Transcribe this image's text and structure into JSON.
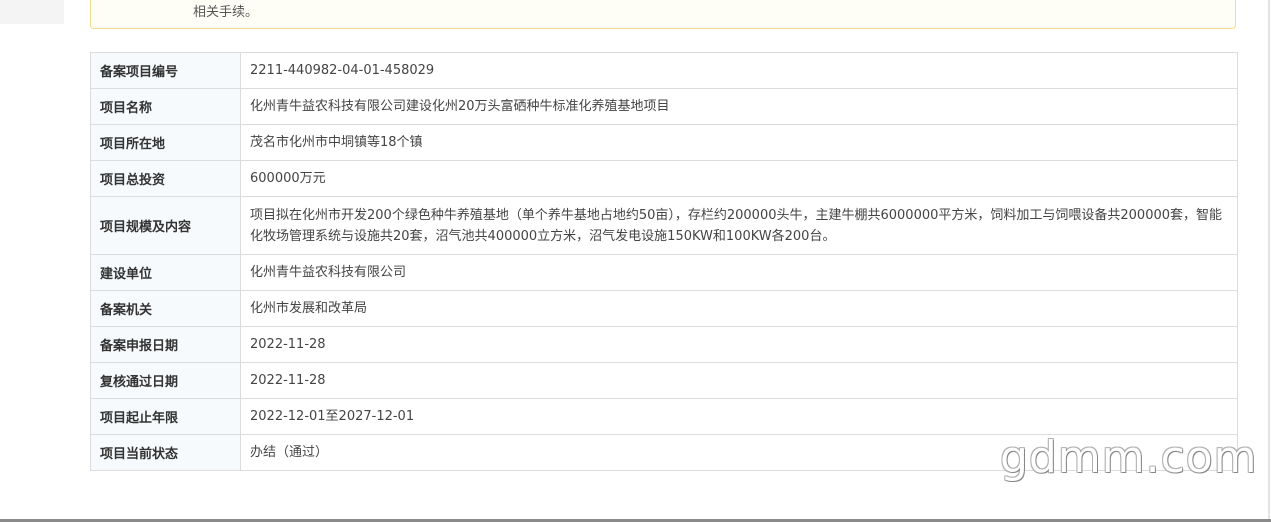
{
  "notice": {
    "text": "相关手续。"
  },
  "record": {
    "rows": [
      {
        "label": "备案项目编号",
        "value": "2211-440982-04-01-458029"
      },
      {
        "label": "项目名称",
        "value": "化州青牛益农科技有限公司建设化州20万头富硒种牛标准化养殖基地项目"
      },
      {
        "label": "项目所在地",
        "value": "茂名市化州市中垌镇等18个镇"
      },
      {
        "label": "项目总投资",
        "value": "600000万元"
      },
      {
        "label": "项目规模及内容",
        "value": "项目拟在化州市开发200个绿色种牛养殖基地（单个养牛基地占地约50亩），存栏约200000头牛，主建牛棚共6000000平方米，饲料加工与饲喂设备共200000套，智能化牧场管理系统与设施共20套，沼气池共400000立方米，沼气发电设施150KW和100KW各200台。"
      },
      {
        "label": "建设单位",
        "value": "化州青牛益农科技有限公司"
      },
      {
        "label": "备案机关",
        "value": "化州市发展和改革局"
      },
      {
        "label": "备案申报日期",
        "value": "2022-11-28"
      },
      {
        "label": "复核通过日期",
        "value": "2022-11-28"
      },
      {
        "label": "项目起止年限",
        "value": "2022-12-01至2027-12-01"
      },
      {
        "label": "项目当前状态",
        "value": "办结（通过）"
      }
    ]
  },
  "watermark": {
    "text": "gdmm.com"
  }
}
